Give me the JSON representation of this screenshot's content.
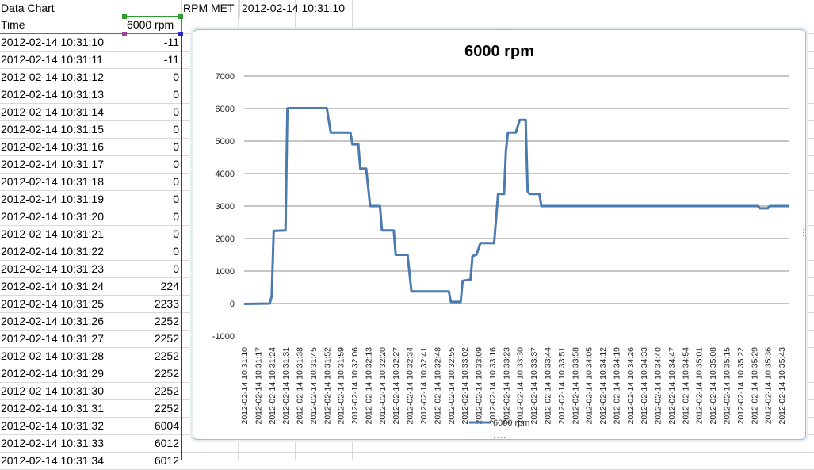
{
  "sheet": {
    "a1": "Data Chart",
    "c1": "RPM MET",
    "d1": "2012-02-14 10:31:10",
    "header_a": "Time",
    "header_b": "6000 rpm",
    "rows": [
      {
        "time": "2012-02-14 10:31:10",
        "rpm": "-11"
      },
      {
        "time": "2012-02-14 10:31:11",
        "rpm": "-11"
      },
      {
        "time": "2012-02-14 10:31:12",
        "rpm": "0"
      },
      {
        "time": "2012-02-14 10:31:13",
        "rpm": "0"
      },
      {
        "time": "2012-02-14 10:31:14",
        "rpm": "0"
      },
      {
        "time": "2012-02-14 10:31:15",
        "rpm": "0"
      },
      {
        "time": "2012-02-14 10:31:16",
        "rpm": "0"
      },
      {
        "time": "2012-02-14 10:31:17",
        "rpm": "0"
      },
      {
        "time": "2012-02-14 10:31:18",
        "rpm": "0"
      },
      {
        "time": "2012-02-14 10:31:19",
        "rpm": "0"
      },
      {
        "time": "2012-02-14 10:31:20",
        "rpm": "0"
      },
      {
        "time": "2012-02-14 10:31:21",
        "rpm": "0"
      },
      {
        "time": "2012-02-14 10:31:22",
        "rpm": "0"
      },
      {
        "time": "2012-02-14 10:31:23",
        "rpm": "0"
      },
      {
        "time": "2012-02-14 10:31:24",
        "rpm": "224"
      },
      {
        "time": "2012-02-14 10:31:25",
        "rpm": "2233"
      },
      {
        "time": "2012-02-14 10:31:26",
        "rpm": "2252"
      },
      {
        "time": "2012-02-14 10:31:27",
        "rpm": "2252"
      },
      {
        "time": "2012-02-14 10:31:28",
        "rpm": "2252"
      },
      {
        "time": "2012-02-14 10:31:29",
        "rpm": "2252"
      },
      {
        "time": "2012-02-14 10:31:30",
        "rpm": "2252"
      },
      {
        "time": "2012-02-14 10:31:31",
        "rpm": "2252"
      },
      {
        "time": "2012-02-14 10:31:32",
        "rpm": "6004"
      },
      {
        "time": "2012-02-14 10:31:33",
        "rpm": "6012"
      },
      {
        "time": "2012-02-14 10:31:34",
        "rpm": "6012"
      }
    ]
  },
  "colors": {
    "series": "#4a7ab0",
    "grid": "#8c8c8c",
    "selection_blue": "#2b2bd0",
    "selection_green": "#2f9c2f"
  },
  "chart_data": {
    "type": "line",
    "title": "6000 rpm",
    "ylim": [
      -1000,
      7000
    ],
    "yticks": [
      7000,
      6000,
      5000,
      4000,
      3000,
      2000,
      1000,
      0,
      -1000
    ],
    "grid": true,
    "legend_position": "bottom",
    "tick_labels": [
      "2012-02-14 10:31:10",
      "2012-02-14 10:31:17",
      "2012-02-14 10:31:24",
      "2012-02-14 10:31:31",
      "2012-02-14 10:31:38",
      "2012-02-14 10:31:45",
      "2012-02-14 10:31:52",
      "2012-02-14 10:31:59",
      "2012-02-14 10:32:06",
      "2012-02-14 10:32:13",
      "2012-02-14 10:32:20",
      "2012-02-14 10:32:27",
      "2012-02-14 10:32:34",
      "2012-02-14 10:32:41",
      "2012-02-14 10:32:48",
      "2012-02-14 10:32:55",
      "2012-02-14 10:33:02",
      "2012-02-14 10:33:09",
      "2012-02-14 10:33:16",
      "2012-02-14 10:33:23",
      "2012-02-14 10:33:30",
      "2012-02-14 10:33:37",
      "2012-02-14 10:33:44",
      "2012-02-14 10:33:51",
      "2012-02-14 10:33:58",
      "2012-02-14 10:34:05",
      "2012-02-14 10:34:12",
      "2012-02-14 10:34:19",
      "2012-02-14 10:34:26",
      "2012-02-14 10:34:33",
      "2012-02-14 10:34:40",
      "2012-02-14 10:34:47",
      "2012-02-14 10:34:54",
      "2012-02-14 10:35:01",
      "2012-02-14 10:35:08",
      "2012-02-14 10:35:15",
      "2012-02-14 10:35:22",
      "2012-02-14 10:35:29",
      "2012-02-14 10:35:36",
      "2012-02-14 10:35:43"
    ],
    "series": [
      {
        "name": "6000 rpm",
        "points": [
          {
            "t": "10:31:10",
            "v": -11
          },
          {
            "t": "10:31:23",
            "v": 0
          },
          {
            "t": "10:31:24",
            "v": 224
          },
          {
            "t": "10:31:25",
            "v": 2233
          },
          {
            "t": "10:31:31",
            "v": 2252
          },
          {
            "t": "10:31:32",
            "v": 6004
          },
          {
            "t": "10:31:33",
            "v": 6012
          },
          {
            "t": "10:31:52",
            "v": 6012
          },
          {
            "t": "10:31:54",
            "v": 5260
          },
          {
            "t": "10:32:04",
            "v": 5260
          },
          {
            "t": "10:32:05",
            "v": 4900
          },
          {
            "t": "10:32:08",
            "v": 4900
          },
          {
            "t": "10:32:09",
            "v": 4150
          },
          {
            "t": "10:32:12",
            "v": 4150
          },
          {
            "t": "10:32:14",
            "v": 3000
          },
          {
            "t": "10:32:19",
            "v": 3000
          },
          {
            "t": "10:32:20",
            "v": 2250
          },
          {
            "t": "10:32:26",
            "v": 2250
          },
          {
            "t": "10:32:27",
            "v": 1500
          },
          {
            "t": "10:32:33",
            "v": 1500
          },
          {
            "t": "10:32:35",
            "v": 370
          },
          {
            "t": "10:32:54",
            "v": 370
          },
          {
            "t": "10:32:55",
            "v": 50
          },
          {
            "t": "10:33:00",
            "v": 50
          },
          {
            "t": "10:33:01",
            "v": 700
          },
          {
            "t": "10:33:05",
            "v": 740
          },
          {
            "t": "10:33:06",
            "v": 1460
          },
          {
            "t": "10:33:08",
            "v": 1500
          },
          {
            "t": "10:33:10",
            "v": 1860
          },
          {
            "t": "10:33:17",
            "v": 1860
          },
          {
            "t": "10:33:19",
            "v": 3370
          },
          {
            "t": "10:33:22",
            "v": 3370
          },
          {
            "t": "10:33:23",
            "v": 4700
          },
          {
            "t": "10:33:24",
            "v": 5260
          },
          {
            "t": "10:33:28",
            "v": 5260
          },
          {
            "t": "10:33:30",
            "v": 5650
          },
          {
            "t": "10:33:33",
            "v": 5650
          },
          {
            "t": "10:33:34",
            "v": 3450
          },
          {
            "t": "10:33:35",
            "v": 3370
          },
          {
            "t": "10:33:40",
            "v": 3370
          },
          {
            "t": "10:33:41",
            "v": 3000
          },
          {
            "t": "10:35:31",
            "v": 3000
          },
          {
            "t": "10:35:32",
            "v": 2930
          },
          {
            "t": "10:35:36",
            "v": 2930
          },
          {
            "t": "10:35:37",
            "v": 3000
          },
          {
            "t": "10:35:47",
            "v": 3000
          }
        ]
      }
    ]
  }
}
